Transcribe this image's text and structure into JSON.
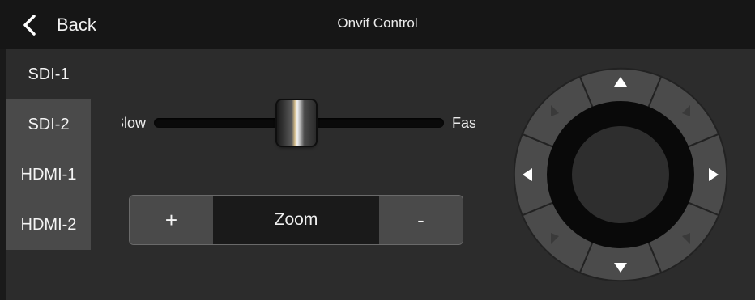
{
  "header": {
    "back_label": "Back",
    "title": "Onvif Control"
  },
  "inputs": [
    "SDI-1",
    "SDI-2",
    "HDMI-1",
    "HDMI-2"
  ],
  "speed_slider": {
    "min_label": "Slow",
    "max_label": "Fast",
    "value_fraction": 0.5
  },
  "zoom": {
    "plus_label": "+",
    "label": "Zoom",
    "minus_label": "-"
  },
  "ptz": {
    "icons": [
      "arrow-up-icon",
      "arrow-down-icon",
      "arrow-left-icon",
      "arrow-right-icon",
      "arrow-up-left-icon",
      "arrow-up-right-icon",
      "arrow-down-left-icon",
      "arrow-down-right-icon"
    ]
  },
  "colors": {
    "background": "#2c2c2c",
    "topbar": "#161616",
    "button": "#4a4a4a",
    "dark": "#1a1a1a"
  }
}
